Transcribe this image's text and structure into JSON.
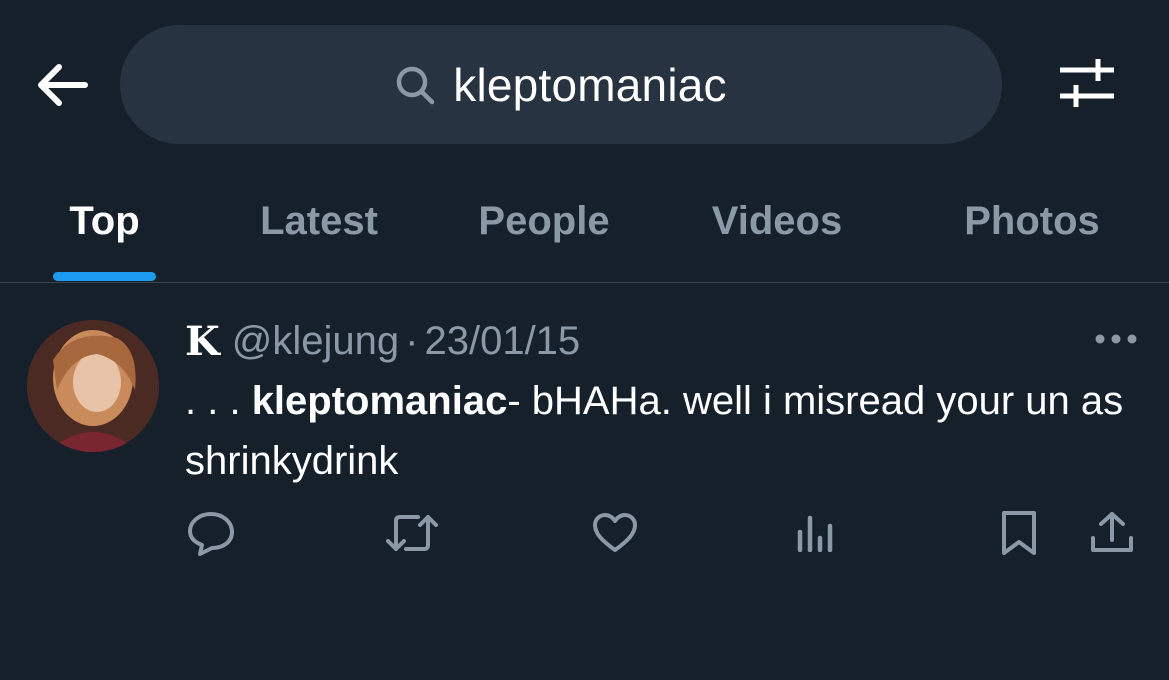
{
  "search": {
    "query": "kleptomaniac"
  },
  "icons": {
    "back": "arrow-left-icon",
    "search": "search-icon",
    "filter": "sliders-icon",
    "more": "more-horizontal-icon",
    "reply": "reply-icon",
    "retweet": "retweet-icon",
    "like": "heart-icon",
    "views": "bar-chart-icon",
    "bookmark": "bookmark-icon",
    "share": "share-icon"
  },
  "tabs": [
    {
      "label": "Top",
      "active": true
    },
    {
      "label": "Latest",
      "active": false
    },
    {
      "label": "People",
      "active": false
    },
    {
      "label": "Videos",
      "active": false
    },
    {
      "label": "Photos",
      "active": false
    }
  ],
  "tweet": {
    "display_name": "K",
    "handle": "@klejung",
    "separator": "·",
    "date": "23/01/15",
    "text_prefix": ". . . ",
    "text_highlight": "kleptomaniac",
    "text_suffix": "- bHAHa. well i misread your un as shrinkydrink"
  },
  "colors": {
    "background": "#15202b",
    "search_bg": "#273340",
    "accent": "#1d9bf0",
    "muted_text": "#8b98a5",
    "primary_text": "#ffffff"
  }
}
